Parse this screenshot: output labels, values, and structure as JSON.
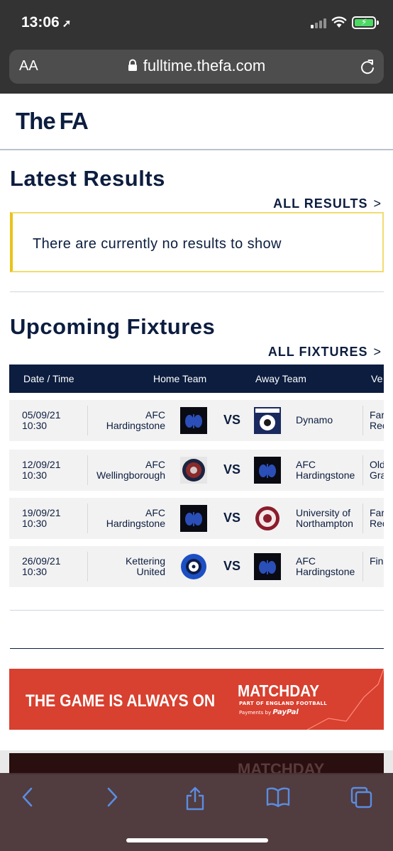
{
  "status_bar": {
    "time": "13:06"
  },
  "browser": {
    "text_size_label": "AA",
    "url": "fulltime.thefa.com"
  },
  "header": {
    "logo_the": "The",
    "logo_fa": "FA"
  },
  "latest_results": {
    "title": "Latest Results",
    "all_link": "ALL RESULTS",
    "empty_message": "There are currently no results to show"
  },
  "upcoming_fixtures": {
    "title": "Upcoming Fixtures",
    "all_link": "ALL FIXTURES",
    "columns": {
      "date_time": "Date / Time",
      "home_team": "Home Team",
      "away_team": "Away Team",
      "venue": "Ve"
    },
    "rows": [
      {
        "date": "05/09/21",
        "time": "10:30",
        "home_line1": "AFC",
        "home_line2": "Hardingstone",
        "vs": "VS",
        "away_line1": "Dynamo",
        "away_line2": "",
        "venue_line1": "Far",
        "venue_line2": "Rec"
      },
      {
        "date": "12/09/21",
        "time": "10:30",
        "home_line1": "AFC",
        "home_line2": "Wellingborough",
        "vs": "VS",
        "away_line1": "AFC",
        "away_line2": "Hardingstone",
        "venue_line1": "Old",
        "venue_line2": "Gra"
      },
      {
        "date": "19/09/21",
        "time": "10:30",
        "home_line1": "AFC",
        "home_line2": "Hardingstone",
        "vs": "VS",
        "away_line1": "University of",
        "away_line2": "Northampton",
        "venue_line1": "Far",
        "venue_line2": "Rec"
      },
      {
        "date": "26/09/21",
        "time": "10:30",
        "home_line1": "Kettering",
        "home_line2": "United",
        "vs": "VS",
        "away_line1": "AFC",
        "away_line2": "Hardingstone",
        "venue_line1": "Fin",
        "venue_line2": ""
      }
    ]
  },
  "ad_banner": {
    "headline": "THE GAME IS ALWAYS ON",
    "brand": "MATCHDAY",
    "subline": "PART OF ENGLAND FOOTBALL",
    "payments_label": "Payments by",
    "payments_brand": "PayPal",
    "color": "#d8402f"
  },
  "ad_banner_2": {
    "brand": "MATCHDAY"
  },
  "colors": {
    "navy": "#0c1d3f",
    "notice_border": "#e9c31a",
    "status_bar": "#333333"
  }
}
